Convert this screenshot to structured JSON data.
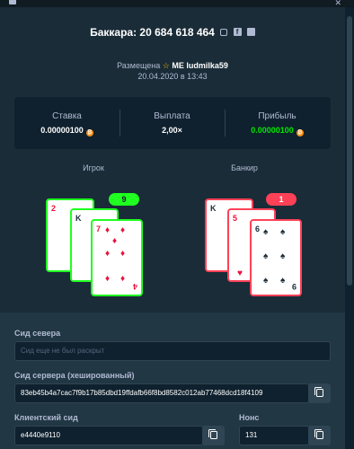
{
  "title": {
    "text": "Баккара: 20 684 618 464"
  },
  "placement": {
    "prefix": "Размещена",
    "user": "ME ludmilka59",
    "datetime": "20.04.2020 в 13:43"
  },
  "stats": {
    "bet_label": "Ставка",
    "bet_value": "0.00000100",
    "payout_label": "Выплата",
    "payout_value": "2,00×",
    "profit_label": "Прибыль",
    "profit_value": "0.00000100",
    "currency_icon": "bitcoin-coin-icon",
    "currency_glyph": "₿"
  },
  "hands": {
    "player_label": "Игрок",
    "player_score": "9",
    "banker_label": "Банкир",
    "banker_score": "1",
    "player_cards": [
      {
        "rank": "2",
        "suit": "♦",
        "color": "red"
      },
      {
        "rank": "K",
        "suit": "♦",
        "color": "red"
      },
      {
        "rank": "7",
        "suit": "♦",
        "color": "red"
      }
    ],
    "banker_cards": [
      {
        "rank": "K",
        "suit": "♥",
        "color": "red"
      },
      {
        "rank": "5",
        "suit": "♥",
        "color": "red"
      },
      {
        "rank": "6",
        "suit": "♠",
        "color": "black"
      }
    ],
    "player_corner_br": "4",
    "banker_corner_br": "9"
  },
  "seeds": {
    "server_seed_label": "Сид севера",
    "server_seed_placeholder": "Сид еще не был раскрыт",
    "server_seed_hashed_label": "Сид сервера (хешированный)",
    "server_seed_hashed_value": "83eb45b4a7cac7f9b17b85dbd19ffdafb66f8bd8582c012ab77468dcd18f4109",
    "client_seed_label": "Клиентский сид",
    "client_seed_value": "e4440e9110",
    "nonce_label": "Нонс",
    "nonce_value": "131"
  },
  "colors": {
    "win": "#1fff20",
    "lose": "#ff4157",
    "profit": "#00e701",
    "bg": "#1a2c38"
  }
}
